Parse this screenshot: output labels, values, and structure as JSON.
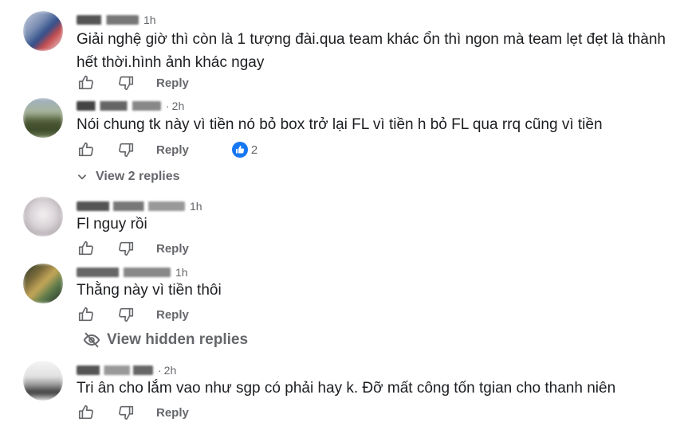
{
  "comments": [
    {
      "time": "1h",
      "text": "Giải nghệ giờ thì còn là 1 tượng đài.qua team khác ổn thì ngon mà team lẹt đẹt là thành hết thời.hình ảnh khác ngay",
      "reply_label": "Reply"
    },
    {
      "time": "2h",
      "text": "Nói chung tk này vì tiền nó bỏ box trở lại FL vì tiền h bỏ FL qua rrq cũng vì tiền",
      "reply_label": "Reply",
      "reaction_count": "2",
      "view_replies_label": "View 2 replies"
    },
    {
      "time": "1h",
      "text": "Fl nguy rồi",
      "reply_label": "Reply"
    },
    {
      "time": "1h",
      "text": "Thằng này vì tiền thôi",
      "reply_label": "Reply",
      "hidden_replies_label": "View hidden replies"
    },
    {
      "time": "2h",
      "text": "Tri ân cho lắm vao như sgp có phải hay k. Đỡ mất công tốn tgian cho thanh niên",
      "reply_label": "Reply"
    }
  ],
  "dot_separator": "·",
  "colors": {
    "text": "#1c1e21",
    "meta": "#65676b",
    "like_blue": "#1877f2"
  },
  "icons": {
    "like": "thumbs-up-icon",
    "dislike": "thumbs-down-icon",
    "chevron": "chevron-down-icon",
    "eye": "eye-slash-icon"
  }
}
